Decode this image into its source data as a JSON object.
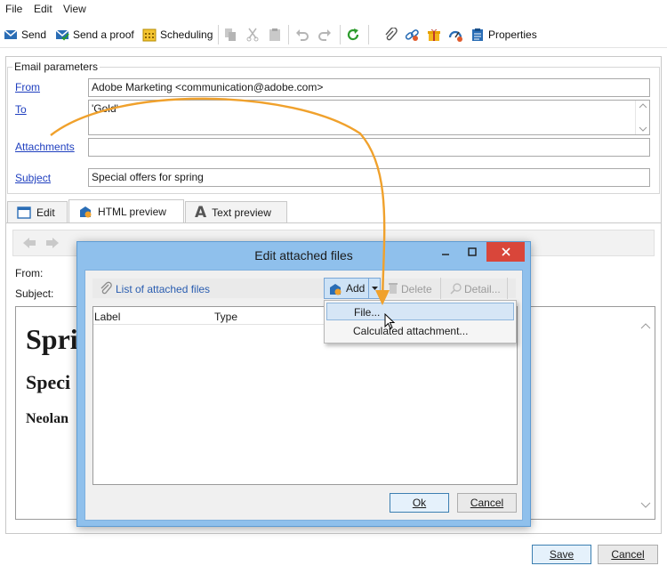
{
  "menu": [
    "File",
    "Edit",
    "View"
  ],
  "toolbar": {
    "send": "Send",
    "send_proof": "Send a proof",
    "scheduling": "Scheduling",
    "properties": "Properties"
  },
  "email_params": {
    "group_title": "Email parameters",
    "from_label": "From",
    "from_value": "Adobe Marketing <communication@adobe.com>",
    "to_label": "To",
    "to_value": "'Gold'",
    "attachments_label": "Attachments",
    "attachments_value": "",
    "subject_label": "Subject",
    "subject_value": "Special offers for spring"
  },
  "tabs": [
    "Edit",
    "HTML preview",
    "Text preview"
  ],
  "preview": {
    "from_label": "From:",
    "subject_label": "Subject:",
    "heading1": "Spri",
    "heading2": "Speci",
    "heading3": "Neolan"
  },
  "dialog": {
    "title": "Edit attached files",
    "list_label": "List of attached files",
    "add_label": "Add",
    "delete_label": "Delete",
    "detail_label": "Detail...",
    "columns": [
      "Label",
      "Type"
    ],
    "ok_label": "Ok",
    "cancel_label": "Cancel"
  },
  "dropdown": {
    "items": [
      "File...",
      "Calculated attachment..."
    ]
  },
  "footer": {
    "save_label": "Save",
    "cancel_label": "Cancel"
  },
  "colors": {
    "link": "#1f3fbf",
    "arrow": "#f0a12c",
    "dialog_frame": "#8fc0ec",
    "close_button": "#d9463a"
  }
}
